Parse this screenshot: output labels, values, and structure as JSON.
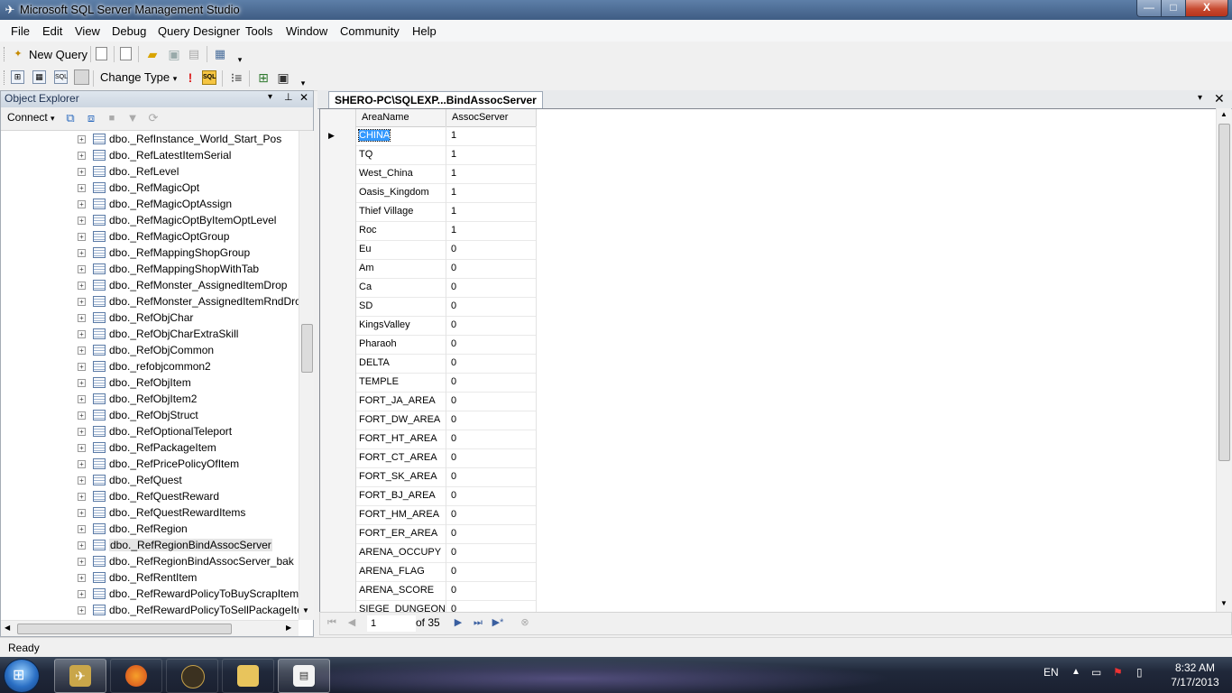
{
  "window": {
    "title": "Microsoft SQL Server Management Studio",
    "min": "—",
    "max": "□",
    "close": "X"
  },
  "menu": [
    "File",
    "Edit",
    "View",
    "Debug",
    "Query Designer",
    "Tools",
    "Window",
    "Community",
    "Help"
  ],
  "toolbar1": {
    "new_query": "New Query"
  },
  "toolbar2": {
    "change_type": "Change Type",
    "change_type_arrow": "▾"
  },
  "object_explorer": {
    "title": "Object Explorer",
    "connect": "Connect",
    "connect_arrow": "▾",
    "items": [
      "dbo._RefInstance_World_Start_Pos",
      "dbo._RefLatestItemSerial",
      "dbo._RefLevel",
      "dbo._RefMagicOpt",
      "dbo._RefMagicOptAssign",
      "dbo._RefMagicOptByItemOptLevel",
      "dbo._RefMagicOptGroup",
      "dbo._RefMappingShopGroup",
      "dbo._RefMappingShopWithTab",
      "dbo._RefMonster_AssignedItemDrop",
      "dbo._RefMonster_AssignedItemRndDro",
      "dbo._RefObjChar",
      "dbo._RefObjCharExtraSkill",
      "dbo._RefObjCommon",
      "dbo._refobjcommon2",
      "dbo._RefObjItem",
      "dbo._RefObjItem2",
      "dbo._RefObjStruct",
      "dbo._RefOptionalTeleport",
      "dbo._RefPackageItem",
      "dbo._RefPricePolicyOfItem",
      "dbo._RefQuest",
      "dbo._RefQuestReward",
      "dbo._RefQuestRewardItems",
      "dbo._RefRegion",
      "dbo._RefRegionBindAssocServer",
      "dbo._RefRegionBindAssocServer_bak",
      "dbo._RefRentItem",
      "dbo._RefRewardPolicyToBuyScrapItem",
      "dbo._RefRewardPolicyToSellPackageIter"
    ],
    "selected_index": 25
  },
  "document": {
    "tab_title": "SHERO-PC\\SQLEXP...BindAssocServer",
    "columns": [
      "AreaName",
      "AssocServer"
    ],
    "rows": [
      [
        "CHINA",
        "1"
      ],
      [
        "TQ",
        "1"
      ],
      [
        "West_China",
        "1"
      ],
      [
        "Oasis_Kingdom",
        "1"
      ],
      [
        "Thief Village",
        "1"
      ],
      [
        "Roc",
        "1"
      ],
      [
        "Eu",
        "0"
      ],
      [
        "Am",
        "0"
      ],
      [
        "Ca",
        "0"
      ],
      [
        "SD",
        "0"
      ],
      [
        "KingsValley",
        "0"
      ],
      [
        "Pharaoh",
        "0"
      ],
      [
        "DELTA",
        "0"
      ],
      [
        "TEMPLE",
        "0"
      ],
      [
        "FORT_JA_AREA",
        "0"
      ],
      [
        "FORT_DW_AREA",
        "0"
      ],
      [
        "FORT_HT_AREA",
        "0"
      ],
      [
        "FORT_CT_AREA",
        "0"
      ],
      [
        "FORT_SK_AREA",
        "0"
      ],
      [
        "FORT_BJ_AREA",
        "0"
      ],
      [
        "FORT_HM_AREA",
        "0"
      ],
      [
        "FORT_ER_AREA",
        "0"
      ],
      [
        "ARENA_OCCUPY",
        "0"
      ],
      [
        "ARENA_FLAG",
        "0"
      ],
      [
        "ARENA_SCORE",
        "0"
      ],
      [
        "SIEGE_DUNGEON",
        "0"
      ]
    ],
    "nav": {
      "position": "1",
      "of_total": "of 35"
    }
  },
  "status": {
    "text": "Ready"
  },
  "taskbar": {
    "lang": "EN",
    "time": "8:32 AM",
    "date": "7/17/2013"
  },
  "icons": [
    "app-icon",
    "new-query-icon",
    "save-icon",
    "open-icon",
    "print-icon",
    "execute-icon",
    "sql-icon",
    "connect-icon",
    "filter-icon",
    "refresh-icon",
    "expand-icon",
    "table-icon",
    "first-record-icon",
    "prev-record-icon",
    "next-record-icon",
    "last-record-icon",
    "new-record-icon",
    "stop-icon",
    "start-orb-icon",
    "firefox-icon",
    "folder-icon",
    "flag-icon",
    "volume-icon",
    "network-icon"
  ]
}
